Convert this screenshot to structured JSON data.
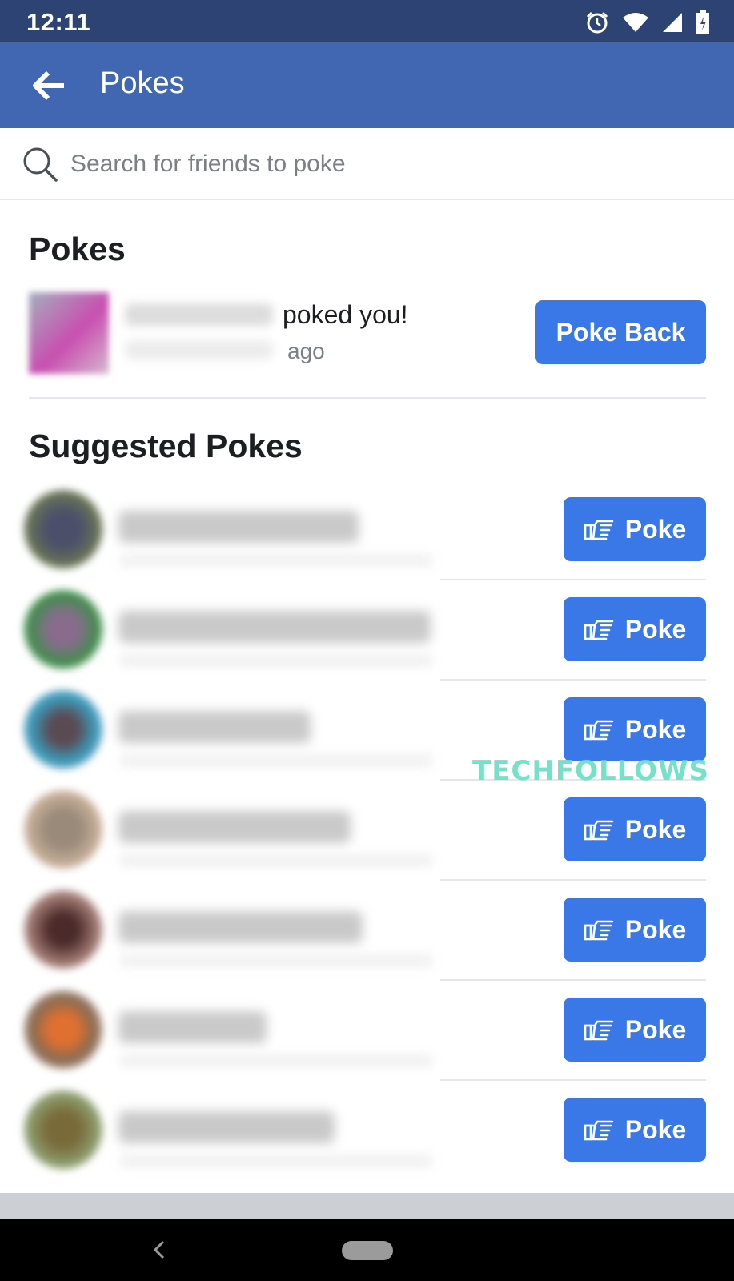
{
  "status_bar": {
    "time": "12:11",
    "icons": [
      "alarm-icon",
      "wifi-icon",
      "signal-icon",
      "battery-icon"
    ]
  },
  "app_bar": {
    "title": "Pokes",
    "back_icon": "arrow-left-icon"
  },
  "search": {
    "placeholder": "Search for friends to poke",
    "value": ""
  },
  "pokes_section": {
    "title": "Pokes",
    "entry": {
      "message": "poked you!",
      "time_suffix": "ago",
      "button_label": "Poke Back"
    }
  },
  "suggested_section": {
    "title": "Suggested Pokes",
    "button_label": "Poke",
    "button_icon": "pointing-hand-icon",
    "items_count_visible": 7
  },
  "watermark": "TECHFOLLOWS",
  "colors": {
    "status_bar": "#2d4373",
    "app_bar": "#4267b2",
    "button": "#3a78e7",
    "watermark": "#6fe0c6"
  }
}
